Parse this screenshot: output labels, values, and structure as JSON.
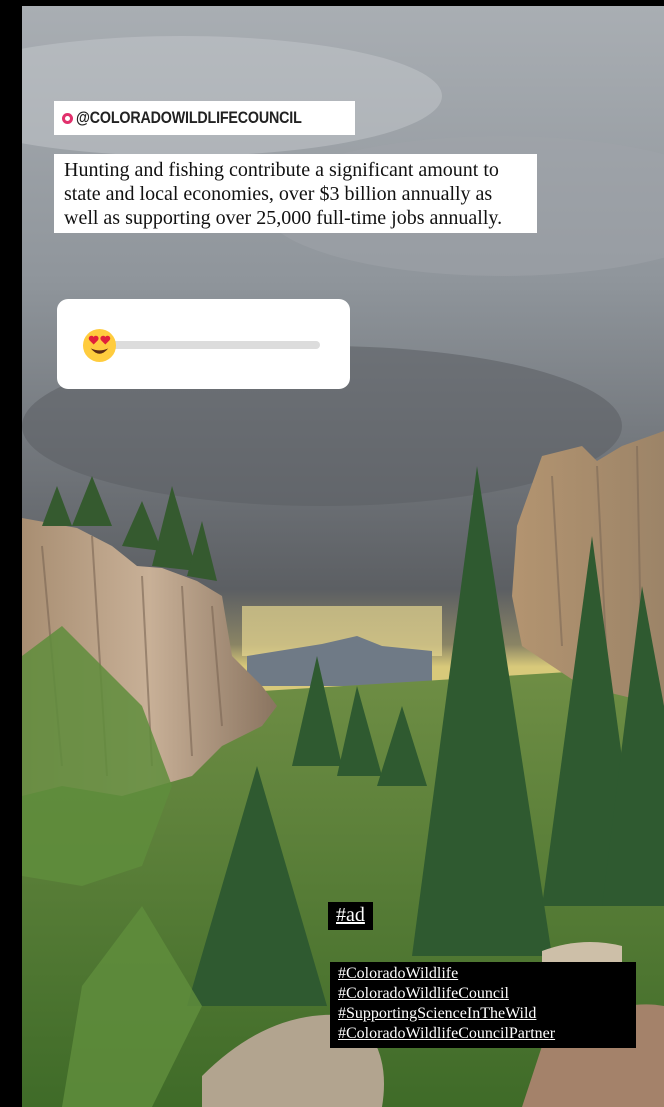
{
  "story": {
    "mention": "@COLORADOWILDLIFECOUNCIL",
    "mention_icon": "at-sign-icon",
    "caption": "Hunting and fishing contribute a significant amount to state and local economies, over $3 billion annually as well as supporting over 25,000 full-time jobs annually.",
    "slider": {
      "emoji": "heart-eyes-emoji",
      "value": 0
    },
    "ad_tag": "#ad",
    "hashtags": [
      "#ColoradoWildlife",
      "#ColoradoWildlifeCouncil",
      "#SupportingScienceInTheWild",
      "#ColoradoWildlifeCouncilPartner"
    ]
  },
  "colors": {
    "background": "#000000",
    "sky": "#6f7378",
    "mention_icon": "#e1306c",
    "slider_track": "#dcdcdc",
    "sticker_bg": "#ffffff",
    "tag_bg": "#000000",
    "tag_text": "#ffffff"
  }
}
